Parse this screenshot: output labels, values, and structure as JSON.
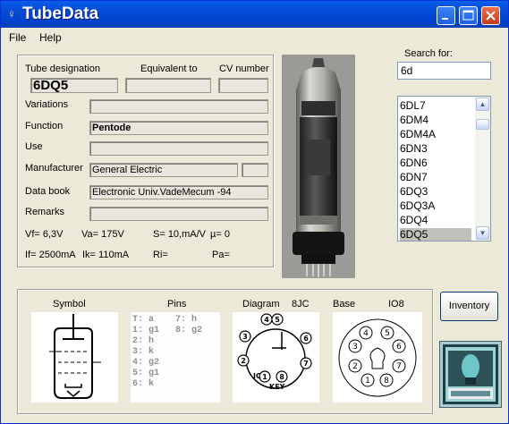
{
  "window": {
    "title": "TubeData"
  },
  "menu": {
    "file": "File",
    "help": "Help"
  },
  "fields": {
    "tube_designation_label": "Tube designation",
    "equivalent_to_label": "Equivalent to",
    "cv_number_label": "CV number",
    "tube_designation": "6DQ5",
    "equivalent_to": "",
    "cv_number": "",
    "variations_label": "Variations",
    "variations": "",
    "function_label": "Function",
    "function": "Pentode",
    "use_label": "Use",
    "use": "",
    "manufacturer_label": "Manufacturer",
    "manufacturer": "General Electric",
    "manufacturer_extra": "",
    "data_book_label": "Data book",
    "data_book": "Electronic Univ.VadeMecum -94",
    "remarks_label": "Remarks",
    "remarks": ""
  },
  "specs": {
    "vf": "Vf= 6,3V",
    "va": "Va= 175V",
    "s": "S= 10,mA/V",
    "mu": "µ=   0",
    "if": "If= 2500mA",
    "ik": "Ik=  110mA",
    "ri": "Ri=",
    "pa": "Pa="
  },
  "search": {
    "label": "Search for:",
    "value": "6d",
    "results": [
      "6DL7",
      "6DM4",
      "6DM4A",
      "6DN3",
      "6DN6",
      "6DN7",
      "6DQ3",
      "6DQ3A",
      "6DQ4",
      "6DQ5"
    ],
    "selected": "6DQ5"
  },
  "bottom": {
    "symbol_label": "Symbol",
    "pins_label": "Pins",
    "diagram_label": "Diagram",
    "diagram_code": "8JC",
    "base_label": "Base",
    "base_code": "IO8",
    "pins_col1": [
      "T: a",
      "1: g1",
      "2: h",
      "3: k",
      "4: g2",
      "5: g1",
      "6: k"
    ],
    "pins_col2": [
      "7: h",
      "8: g2"
    ],
    "diagram_key": "KEY",
    "diagram_ic": "IC",
    "base_pins": [
      "1",
      "2",
      "3",
      "4",
      "5",
      "6",
      "7",
      "8"
    ]
  },
  "inventory_button": "Inventory",
  "colors": {
    "titlebar": "#0449d6",
    "window_bg": "#ece9d8",
    "selection": "#c1c0bb"
  }
}
